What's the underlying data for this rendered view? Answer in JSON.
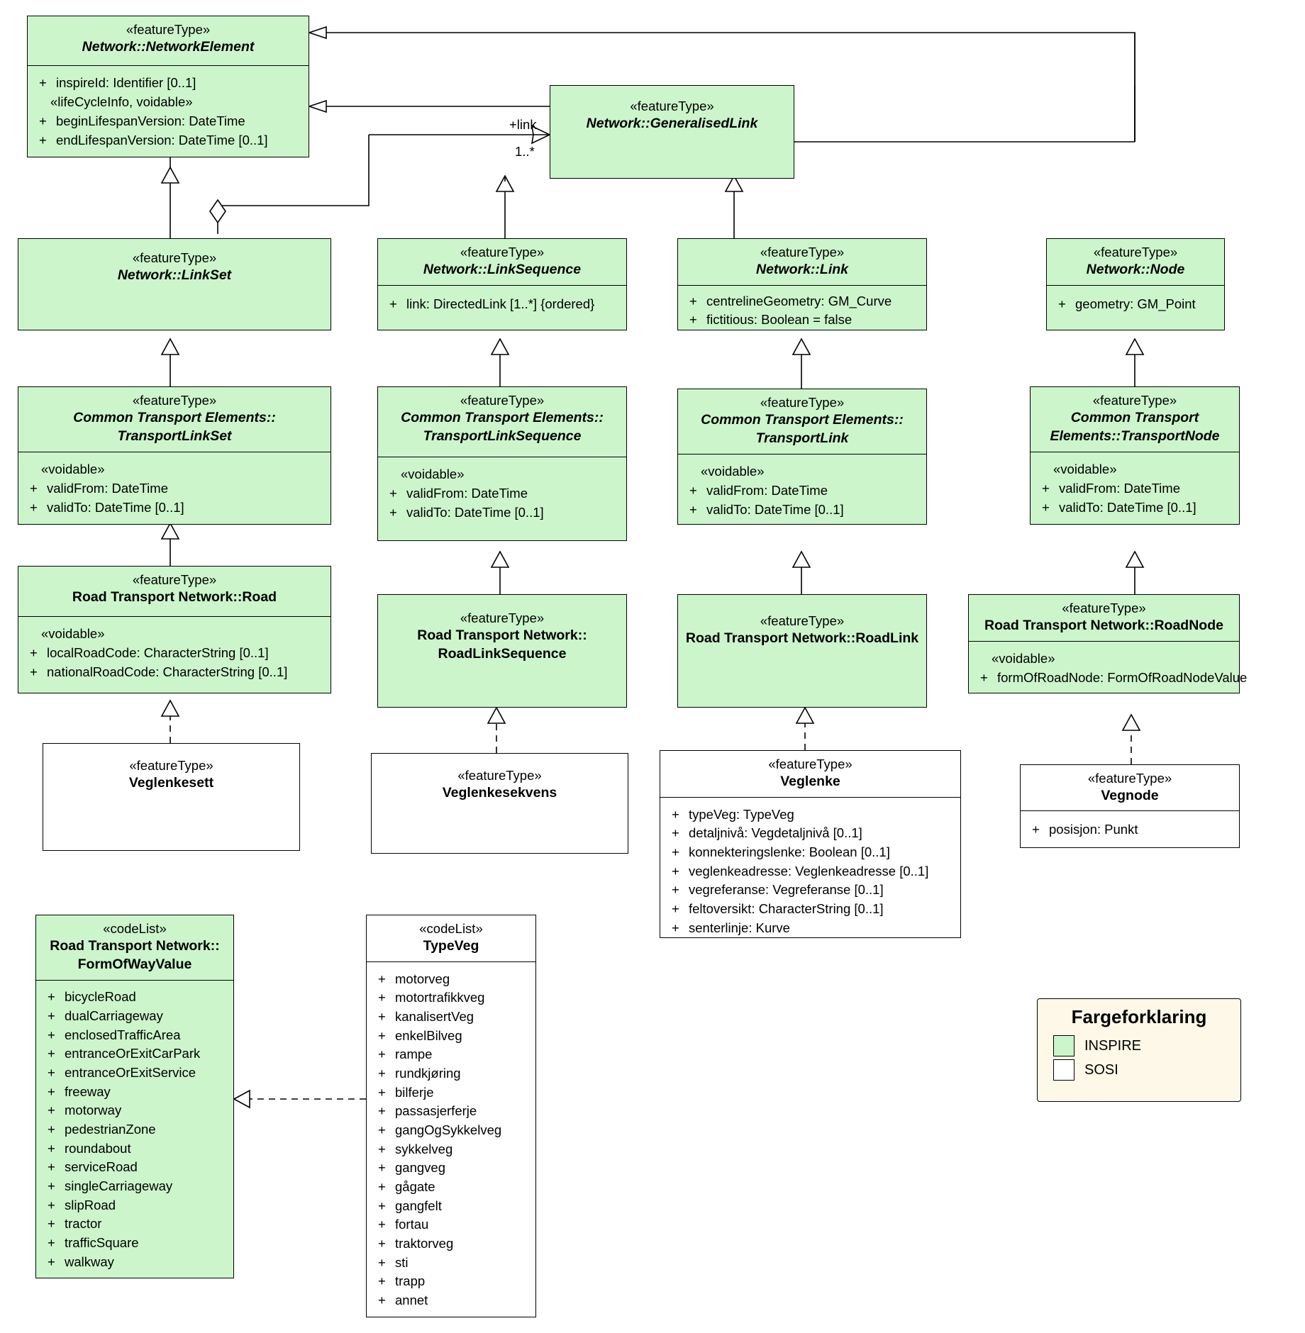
{
  "diagram": {
    "title": "Road Transport Network UML class diagram",
    "colors": {
      "inspire_fill": "#ccf5cc",
      "sosi_fill": "#ffffff",
      "legend_fill": "#fdf8e8",
      "line": "#000000"
    }
  },
  "classes": {
    "network_element": {
      "stereotype": "«featureType»",
      "name": "Network::NetworkElement",
      "group_stereotype": "«lifeCycleInfo, voidable»",
      "attributes": [
        {
          "vis": "+",
          "text": "inspireId: Identifier [0..1]"
        },
        {
          "vis": "+",
          "text": "beginLifespanVersion: DateTime"
        },
        {
          "vis": "+",
          "text": "endLifespanVersion: DateTime [0..1]"
        }
      ]
    },
    "generalised_link": {
      "stereotype": "«featureType»",
      "name": "Network::GeneralisedLink",
      "attributes": []
    },
    "link_set": {
      "stereotype": "«featureType»",
      "name": "Network::LinkSet",
      "attributes": []
    },
    "link_sequence": {
      "stereotype": "«featureType»",
      "name": "Network::LinkSequence",
      "attributes": [
        {
          "vis": "+",
          "text": "link: DirectedLink [1..*] {ordered}"
        }
      ]
    },
    "link": {
      "stereotype": "«featureType»",
      "name": "Network::Link",
      "attributes": [
        {
          "vis": "+",
          "text": "centrelineGeometry: GM_Curve"
        },
        {
          "vis": "+",
          "text": "fictitious: Boolean = false"
        }
      ]
    },
    "node": {
      "stereotype": "«featureType»",
      "name": "Network::Node",
      "attributes": [
        {
          "vis": "+",
          "text": "geometry: GM_Point"
        }
      ]
    },
    "transport_link_set": {
      "stereotype": "«featureType»",
      "name_line1": "Common Transport Elements::",
      "name_line2": "TransportLinkSet",
      "group_stereotype": "«voidable»",
      "attributes": [
        {
          "vis": "+",
          "text": "validFrom: DateTime"
        },
        {
          "vis": "+",
          "text": "validTo: DateTime [0..1]"
        }
      ]
    },
    "transport_link_sequence": {
      "stereotype": "«featureType»",
      "name_line1": "Common Transport Elements::",
      "name_line2": "TransportLinkSequence",
      "group_stereotype": "«voidable»",
      "attributes": [
        {
          "vis": "+",
          "text": "validFrom: DateTime"
        },
        {
          "vis": "+",
          "text": "validTo: DateTime [0..1]"
        }
      ]
    },
    "transport_link": {
      "stereotype": "«featureType»",
      "name_line1": "Common Transport Elements::",
      "name_line2": "TransportLink",
      "group_stereotype": "«voidable»",
      "attributes": [
        {
          "vis": "+",
          "text": "validFrom: DateTime"
        },
        {
          "vis": "+",
          "text": "validTo: DateTime [0..1]"
        }
      ]
    },
    "transport_node": {
      "stereotype": "«featureType»",
      "name_line1": "Common Transport",
      "name_line2": "Elements::TransportNode",
      "group_stereotype": "«voidable»",
      "attributes": [
        {
          "vis": "+",
          "text": "validFrom: DateTime"
        },
        {
          "vis": "+",
          "text": "validTo: DateTime [0..1]"
        }
      ]
    },
    "road": {
      "stereotype": "«featureType»",
      "name": "Road Transport Network::Road",
      "group_stereotype": "«voidable»",
      "attributes": [
        {
          "vis": "+",
          "text": "localRoadCode: CharacterString [0..1]"
        },
        {
          "vis": "+",
          "text": "nationalRoadCode: CharacterString [0..1]"
        }
      ]
    },
    "road_link_sequence": {
      "stereotype": "«featureType»",
      "name_line1": "Road Transport Network::",
      "name_line2": "RoadLinkSequence",
      "attributes": []
    },
    "road_link": {
      "stereotype": "«featureType»",
      "name": "Road Transport Network::RoadLink",
      "attributes": []
    },
    "road_node": {
      "stereotype": "«featureType»",
      "name": "Road Transport Network::RoadNode",
      "group_stereotype": "«voidable»",
      "attributes": [
        {
          "vis": "+",
          "text": "formOfRoadNode: FormOfRoadNodeValue"
        }
      ]
    },
    "veglenkesett": {
      "stereotype": "«featureType»",
      "name": "Veglenkesett",
      "attributes": []
    },
    "veglenkesekvens": {
      "stereotype": "«featureType»",
      "name": "Veglenkesekvens",
      "attributes": []
    },
    "veglenke": {
      "stereotype": "«featureType»",
      "name": "Veglenke",
      "attributes": [
        {
          "vis": "+",
          "text": "typeVeg: TypeVeg"
        },
        {
          "vis": "+",
          "text": "detaljnivå: Vegdetaljnivå [0..1]"
        },
        {
          "vis": "+",
          "text": "konnekteringslenke: Boolean [0..1]"
        },
        {
          "vis": "+",
          "text": "veglenkeadresse: Veglenkeadresse [0..1]"
        },
        {
          "vis": "+",
          "text": "vegreferanse: Vegreferanse [0..1]"
        },
        {
          "vis": "+",
          "text": "feltoversikt: CharacterString [0..1]"
        },
        {
          "vis": "+",
          "text": "senterlinje: Kurve"
        }
      ]
    },
    "vegnode": {
      "stereotype": "«featureType»",
      "name": "Vegnode",
      "attributes": [
        {
          "vis": "+",
          "text": "posisjon: Punkt"
        }
      ]
    },
    "form_of_way_value": {
      "stereotype": "«codeList»",
      "name_line1": "Road Transport Network::",
      "name_line2": "FormOfWayValue",
      "attributes": [
        {
          "vis": "+",
          "text": "bicycleRoad"
        },
        {
          "vis": "+",
          "text": "dualCarriageway"
        },
        {
          "vis": "+",
          "text": "enclosedTrafficArea"
        },
        {
          "vis": "+",
          "text": "entranceOrExitCarPark"
        },
        {
          "vis": "+",
          "text": "entranceOrExitService"
        },
        {
          "vis": "+",
          "text": "freeway"
        },
        {
          "vis": "+",
          "text": "motorway"
        },
        {
          "vis": "+",
          "text": "pedestrianZone"
        },
        {
          "vis": "+",
          "text": "roundabout"
        },
        {
          "vis": "+",
          "text": "serviceRoad"
        },
        {
          "vis": "+",
          "text": "singleCarriageway"
        },
        {
          "vis": "+",
          "text": "slipRoad"
        },
        {
          "vis": "+",
          "text": "tractor"
        },
        {
          "vis": "+",
          "text": "trafficSquare"
        },
        {
          "vis": "+",
          "text": "walkway"
        }
      ]
    },
    "type_veg": {
      "stereotype": "«codeList»",
      "name": "TypeVeg",
      "attributes": [
        {
          "vis": "+",
          "text": "motorveg"
        },
        {
          "vis": "+",
          "text": "motortrafikkveg"
        },
        {
          "vis": "+",
          "text": "kanalisertVeg"
        },
        {
          "vis": "+",
          "text": "enkelBilveg"
        },
        {
          "vis": "+",
          "text": "rampe"
        },
        {
          "vis": "+",
          "text": "rundkjøring"
        },
        {
          "vis": "+",
          "text": "bilferje"
        },
        {
          "vis": "+",
          "text": "passasjerferje"
        },
        {
          "vis": "+",
          "text": "gangOgSykkelveg"
        },
        {
          "vis": "+",
          "text": "sykkelveg"
        },
        {
          "vis": "+",
          "text": "gangveg"
        },
        {
          "vis": "+",
          "text": "gågate"
        },
        {
          "vis": "+",
          "text": "gangfelt"
        },
        {
          "vis": "+",
          "text": "fortau"
        },
        {
          "vis": "+",
          "text": "traktorveg"
        },
        {
          "vis": "+",
          "text": "sti"
        },
        {
          "vis": "+",
          "text": "trapp"
        },
        {
          "vis": "+",
          "text": "annet"
        }
      ]
    }
  },
  "edge_labels": {
    "link_role": "+link",
    "link_multiplicity": "1..*"
  },
  "legend": {
    "title": "Fargeforklaring",
    "items": [
      {
        "label": "INSPIRE",
        "color": "#ccf5cc"
      },
      {
        "label": "SOSI",
        "color": "#ffffff"
      }
    ]
  }
}
